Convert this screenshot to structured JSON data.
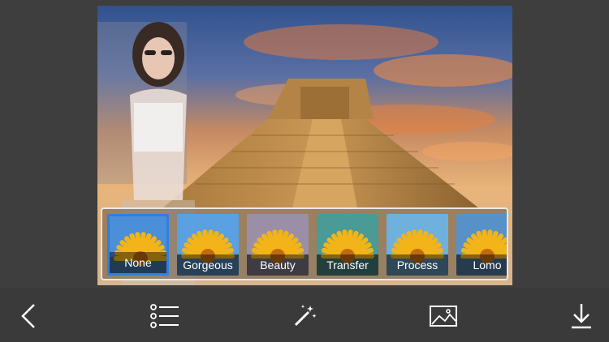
{
  "filters": [
    {
      "label": "None",
      "tint": "#4a8fd8",
      "selected": true
    },
    {
      "label": "Gorgeous",
      "tint": "#5ba0e0",
      "selected": false
    },
    {
      "label": "Beauty",
      "tint": "#9a8fa6",
      "selected": false
    },
    {
      "label": "Transfer",
      "tint": "#4a9a95",
      "selected": false
    },
    {
      "label": "Process",
      "tint": "#6fb0dd",
      "selected": false
    },
    {
      "label": "Lomo",
      "tint": "#5890c8",
      "selected": false
    }
  ],
  "toolbar": {
    "back_icon": "chevron-left-icon",
    "list_icon": "list-icon",
    "magic_icon": "magic-wand-icon",
    "image_icon": "image-icon",
    "download_icon": "download-icon"
  },
  "colors": {
    "selected_border": "#2f7fe0",
    "toolbar_bg": "#3a3a3a",
    "page_bg": "#3e3e3e"
  }
}
